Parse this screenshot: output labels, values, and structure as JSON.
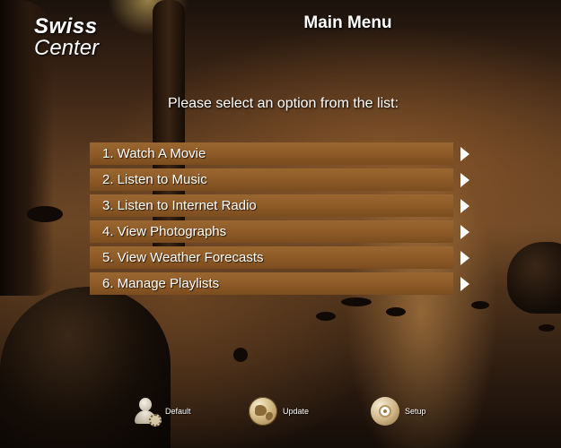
{
  "logo": {
    "line1": "Swiss",
    "line2": "Center"
  },
  "header": {
    "title": "Main Menu"
  },
  "prompt": "Please select an option from the list:",
  "menu": {
    "items": [
      {
        "label": "1. Watch A Movie"
      },
      {
        "label": "2. Listen to Music"
      },
      {
        "label": "3. Listen to Internet Radio"
      },
      {
        "label": "4. View Photographs"
      },
      {
        "label": "5. View Weather Forecasts"
      },
      {
        "label": "6. Manage Playlists"
      }
    ],
    "icon": "arrow-right-icon"
  },
  "footer": {
    "default_label": "Default",
    "default_icon": "user-settings-icon",
    "update_label": "Update",
    "update_icon": "globe-icon",
    "setup_label": "Setup",
    "setup_icon": "disc-icon"
  },
  "colors": {
    "menu_item": "#8d5a27",
    "text": "#ffffff"
  }
}
